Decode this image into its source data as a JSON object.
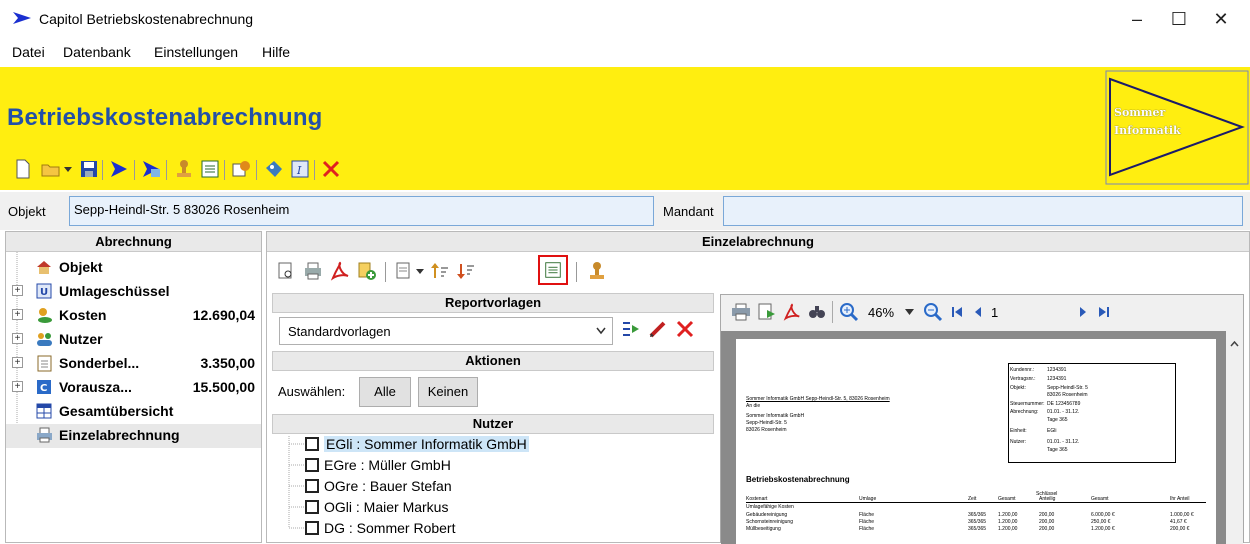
{
  "window": {
    "title": "Capitol Betriebskostenabrechnung"
  },
  "menu": [
    "Datei",
    "Datenbank",
    "Einstellungen",
    "Hilfe"
  ],
  "banner": {
    "title": "Betriebskostenabrechnung",
    "logo_line1": "Sommer",
    "logo_line2": "Informatik"
  },
  "objekt": {
    "label": "Objekt",
    "value": "Sepp-Heindl-Str. 5  83026 Rosenheim",
    "mandant_label": "Mandant",
    "mandant_value": ""
  },
  "left": {
    "header": "Abrechnung",
    "items": [
      {
        "label": "Objekt",
        "value": "",
        "icon": "house-icon",
        "expandable": false
      },
      {
        "label": "Umlageschüssel",
        "value": "",
        "icon": "u-key-icon",
        "expandable": true
      },
      {
        "label": "Kosten",
        "value": "12.690,04",
        "icon": "coins-icon",
        "expandable": true
      },
      {
        "label": "Nutzer",
        "value": "",
        "icon": "users-icon",
        "expandable": true
      },
      {
        "label": "Sonderbel...",
        "value": "3.350,00",
        "icon": "clipboard-icon",
        "expandable": true
      },
      {
        "label": "Vorausza...",
        "value": "15.500,00",
        "icon": "prepay-icon",
        "expandable": true
      },
      {
        "label": "Gesamtübersicht",
        "value": "",
        "icon": "table-icon",
        "expandable": false
      },
      {
        "label": "Einzelabrechnung",
        "value": "",
        "icon": "printer-icon",
        "expandable": false
      }
    ]
  },
  "main": {
    "header": "Einzelabrechnung",
    "reportvorlagen": {
      "header": "Reportvorlagen",
      "selected": "Standardvorlagen"
    },
    "aktionen": {
      "header": "Aktionen",
      "label": "Auswählen:",
      "btn_all": "Alle",
      "btn_none": "Keinen"
    },
    "nutzer": {
      "header": "Nutzer",
      "items": [
        "EGli : Sommer Informatik GmbH",
        "EGre : Müller GmbH",
        "OGre : Bauer Stefan",
        "OGli : Maier Markus",
        "DG : Sommer Robert"
      ]
    },
    "preview": {
      "zoom": "46%",
      "page": "1"
    }
  },
  "doc": {
    "sender": "Sommer Informatik GmbH Sepp-Heindl-Str. 5, 83026 Rosenheim",
    "an": "An die",
    "addr": [
      "Sommer Informatik GmbH",
      "Sepp-Heindl-Str. 5",
      "83026 Rosenheim"
    ],
    "info": [
      [
        "Kundennr.:",
        "1234391"
      ],
      [
        "Vertragsnr.:",
        "1234391"
      ],
      [
        "Objekt:",
        "Sepp-Heindl-Str. 5"
      ],
      [
        "",
        "83026 Rosenheim"
      ],
      [
        "Steuernummer:",
        "DE 123456789"
      ],
      [
        "Abrechnung:",
        "01.01.    -  31.12."
      ],
      [
        "",
        "Tage    365"
      ],
      [
        "Einheit:",
        "EGli"
      ],
      [
        "Nutzer:",
        "01.01.    -  31.12."
      ],
      [
        "",
        "Tage    365"
      ]
    ],
    "heading": "Betriebskostenabrechnung",
    "col_schluessel": "Schlüssel",
    "cols": [
      "Kostenart",
      "Umlage",
      "Zeit",
      "Gesamt",
      "Anteilig",
      "Gesamt",
      "Ihr Anteil"
    ],
    "section": "Umlagefähige Kosten",
    "rows": [
      [
        "Gebäudereinigung",
        "Fläche",
        "365/365",
        "1.200,00",
        "200,00",
        "6.000,00 €",
        "1.000,00 €"
      ],
      [
        "Schornsteinreinigung",
        "Fläche",
        "365/365",
        "1.200,00",
        "200,00",
        "250,00 €",
        "41,67 €"
      ],
      [
        "Müllbeseitigung",
        "Fläche",
        "365/365",
        "1.200,00",
        "200,00",
        "1.200,00 €",
        "200,00 €"
      ]
    ]
  }
}
